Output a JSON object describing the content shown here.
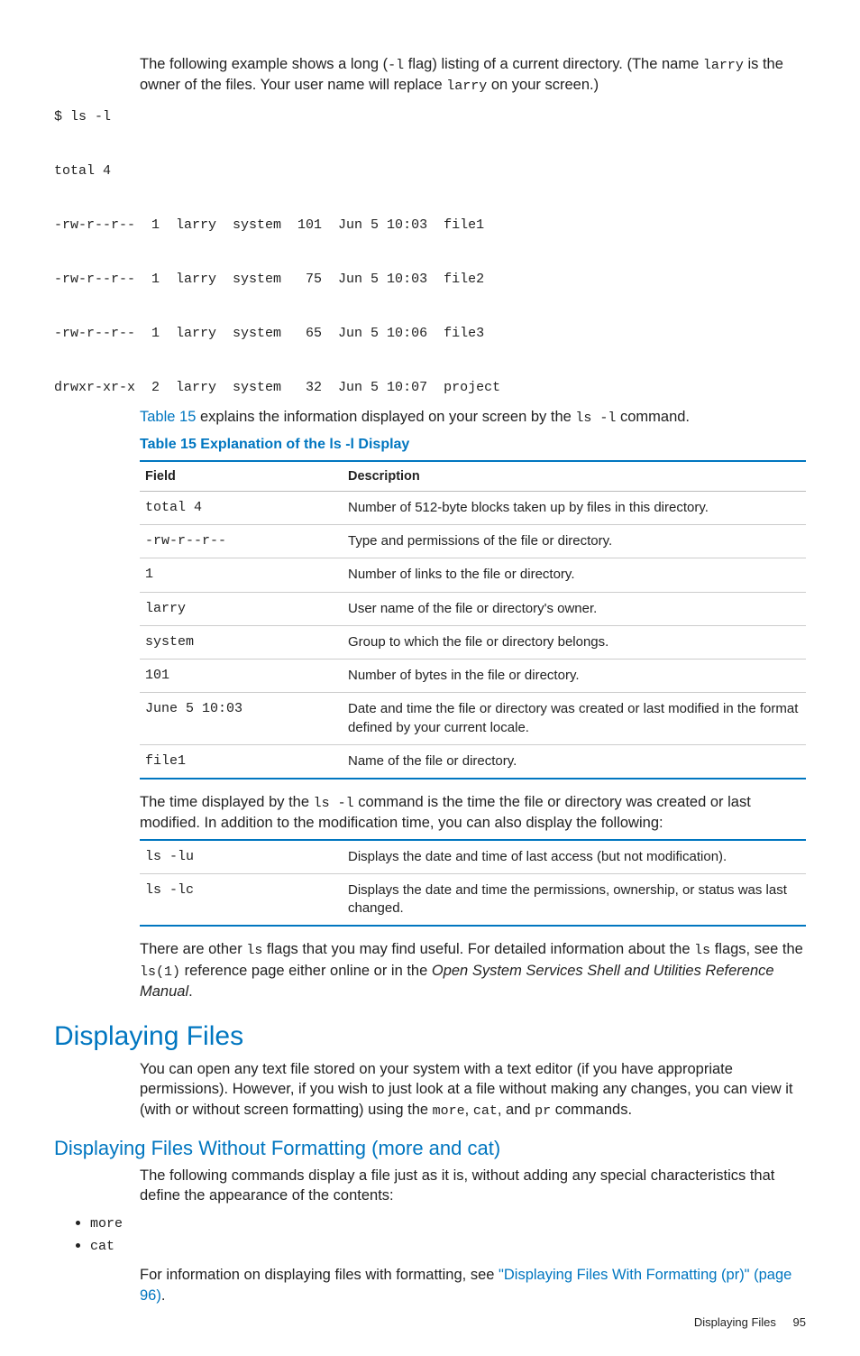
{
  "intro": {
    "p1a": "The following example shows a long (",
    "p1b": "-l",
    "p1c": " flag) listing of a current directory. (The name ",
    "p1d": "larry",
    "p1e": " is the owner of the files. Your user name will replace ",
    "p1f": "larry",
    "p1g": " on your screen.)"
  },
  "code": "$ ls -l\n\ntotal 4\n\n-rw-r--r--  1  larry  system  101  Jun 5 10:03  file1\n\n-rw-r--r--  1  larry  system   75  Jun 5 10:03  file2\n\n-rw-r--r--  1  larry  system   65  Jun 5 10:06  file3\n\ndrwxr-xr-x  2  larry  system   32  Jun 5 10:07  project",
  "after_code": {
    "link": "Table 15",
    "a": " explains the information displayed on your screen by the ",
    "b": "ls -l",
    "c": " command."
  },
  "table15": {
    "caption": "Table 15 Explanation of the ls -l Display",
    "head": {
      "field": "Field",
      "desc": "Description"
    },
    "rows": [
      {
        "f": "total 4",
        "d": "Number of 512-byte blocks taken up by files in this directory."
      },
      {
        "f": "-rw-r--r--",
        "d": "Type and permissions of the file or directory."
      },
      {
        "f": "1",
        "d": "Number of links to the file or directory."
      },
      {
        "f": "larry",
        "d": "User name of the file or directory's owner."
      },
      {
        "f": "system",
        "d": "Group to which the file or directory belongs."
      },
      {
        "f": "101",
        "d": "Number of bytes in the file or directory."
      },
      {
        "f": "June 5 10:03",
        "d": "Date and time the file or directory was created or last modified in the format defined by your current locale."
      },
      {
        "f": "file1",
        "d": "Name of the file or directory."
      }
    ]
  },
  "time_para": {
    "a": "The time displayed by the ",
    "b": "ls -l",
    "c": " command is the time the file or directory was created or last modified. In addition to the modification time, you can also display the following:"
  },
  "table_opts": {
    "rows": [
      {
        "f": "ls -lu",
        "d": "Displays the date and time of last access (but not modification)."
      },
      {
        "f": "ls -lc",
        "d": "Displays the date and time the permissions, ownership, or status was last changed."
      }
    ]
  },
  "other_flags": {
    "a": "There are other ",
    "b": "ls",
    "c": " flags that you may find useful. For detailed information about the ",
    "d": "ls",
    "e": " flags, see the ",
    "f": "ls(1)",
    "g": " reference page either online or in the ",
    "h": "Open System Services Shell and Utilities Reference Manual",
    "i": "."
  },
  "h1": "Displaying Files",
  "df_para": {
    "a": "You can open any text file stored on your system with a text editor (if you have appropriate permissions). However, if you wish to just look at a file without making any changes, you can view it (with or without screen formatting) using the ",
    "b": "more",
    "c": ", ",
    "d": "cat",
    "e": ", and ",
    "f": "pr",
    "g": " commands."
  },
  "h2": "Displaying Files Without Formatting (more and cat)",
  "dfw_para": "The following commands display a file just as it is, without adding any special characteristics that define the appearance of the contents:",
  "bullets": {
    "b1": "more",
    "b2": "cat"
  },
  "info_para": {
    "a": "For information on displaying files with formatting, see ",
    "link": "\"Displaying Files With Formatting (pr)\" (page 96)",
    "b": "."
  },
  "footer": {
    "title": "Displaying Files",
    "page": "95"
  }
}
